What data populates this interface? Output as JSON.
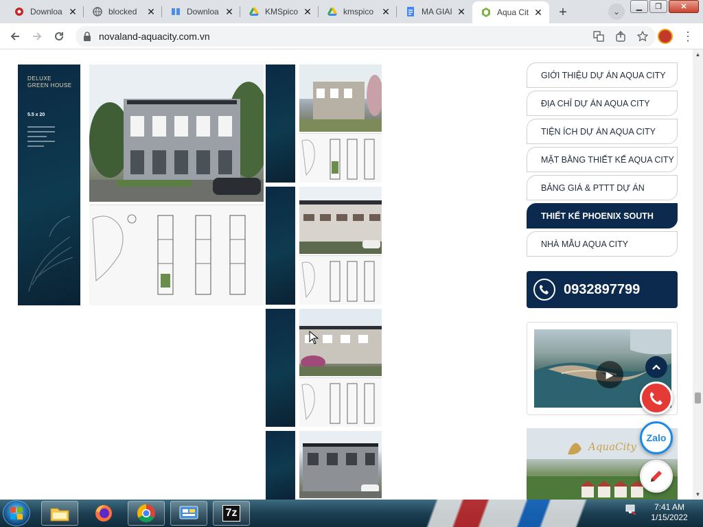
{
  "browser": {
    "tabs": [
      {
        "title": "Downloa",
        "icon": "red-record-icon",
        "active": false
      },
      {
        "title": "blocked",
        "icon": "globe-icon",
        "active": false
      },
      {
        "title": "Downloa",
        "icon": "t-logo-icon",
        "active": false
      },
      {
        "title": "KMSpico",
        "icon": "google-drive-icon",
        "active": false
      },
      {
        "title": "kmspico",
        "icon": "google-drive-icon",
        "active": false
      },
      {
        "title": "MA GIAI",
        "icon": "google-docs-icon",
        "active": false
      },
      {
        "title": "Aqua Cit",
        "icon": "aqua-city-favicon",
        "active": true
      }
    ],
    "url": "novaland-aquacity.com.vn"
  },
  "page": {
    "card_title": "DELUXE\nGREEN HOUSE",
    "card_size": "5.5 x 20",
    "sidebar_menu": [
      {
        "label": "GIỚI THIỆU DỰ ÁN AQUA CITY",
        "active": false
      },
      {
        "label": "ĐỊA CHỈ DỰ ÁN AQUA CITY",
        "active": false
      },
      {
        "label": "TIỆN ÍCH DỰ ÁN AQUA CITY",
        "active": false
      },
      {
        "label": "MẶT BẰNG THIẾT KẾ AQUA CITY",
        "active": false
      },
      {
        "label": "BẢNG GIÁ & PTTT DỰ ÁN",
        "active": false
      },
      {
        "label": "THIẾT KẾ PHOENIX SOUTH",
        "active": true
      },
      {
        "label": "NHÀ MẪU AQUA CITY",
        "active": false
      }
    ],
    "hotline": "0932897799",
    "zalo_label": "Zalo",
    "banner_logo": "AquaCity"
  },
  "taskbar": {
    "time": "7:41 AM",
    "date": "1/15/2022",
    "seven_zip_label": "7z"
  },
  "colors": {
    "navy": "#0c2a4d",
    "call_red": "#e53935",
    "zalo_blue": "#1e88e5"
  }
}
